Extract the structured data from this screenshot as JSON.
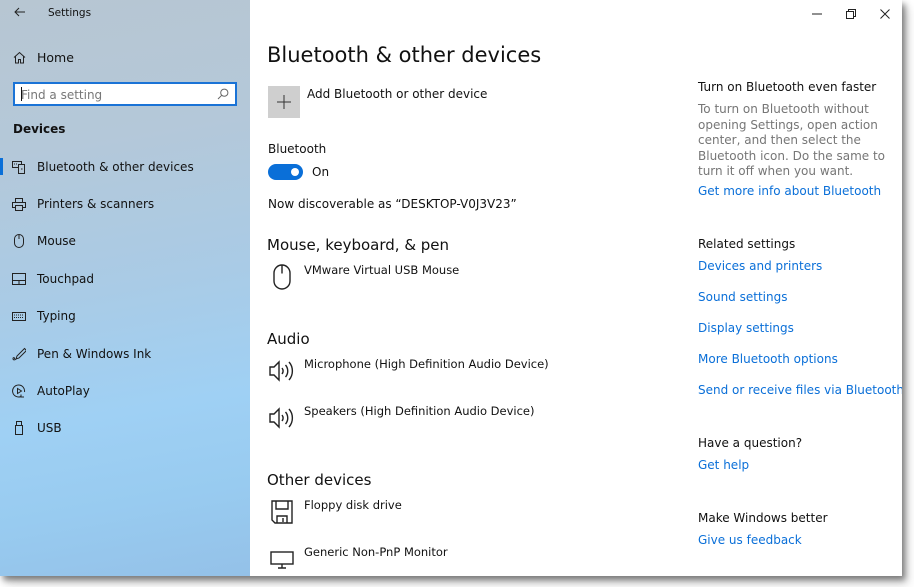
{
  "window": {
    "app_title": "Settings",
    "controls": [
      "minimize",
      "restore",
      "close"
    ]
  },
  "sidebar": {
    "home_label": "Home",
    "search": {
      "placeholder": "Find a setting",
      "value": ""
    },
    "section_label": "Devices",
    "items": [
      {
        "label": "Bluetooth & other devices",
        "icon": "bluetooth-devices-icon",
        "selected": true
      },
      {
        "label": "Printers & scanners",
        "icon": "printer-icon",
        "selected": false
      },
      {
        "label": "Mouse",
        "icon": "mouse-icon",
        "selected": false
      },
      {
        "label": "Touchpad",
        "icon": "touchpad-icon",
        "selected": false
      },
      {
        "label": "Typing",
        "icon": "keyboard-icon",
        "selected": false
      },
      {
        "label": "Pen & Windows Ink",
        "icon": "pen-icon",
        "selected": false
      },
      {
        "label": "AutoPlay",
        "icon": "autoplay-icon",
        "selected": false
      },
      {
        "label": "USB",
        "icon": "usb-icon",
        "selected": false
      }
    ]
  },
  "main": {
    "title": "Bluetooth & other devices",
    "add_device_label": "Add Bluetooth or other device",
    "bluetooth": {
      "label": "Bluetooth",
      "state": "On",
      "enabled": true,
      "discoverable_text": "Now discoverable as “DESKTOP-V0J3V23”"
    },
    "groups": [
      {
        "title": "Mouse, keyboard, & pen",
        "devices": [
          {
            "name": "VMware Virtual USB Mouse",
            "icon": "mouse-icon"
          }
        ]
      },
      {
        "title": "Audio",
        "devices": [
          {
            "name": "Microphone (High Definition Audio Device)",
            "icon": "speaker-icon"
          },
          {
            "name": "Speakers (High Definition Audio Device)",
            "icon": "speaker-icon"
          }
        ]
      },
      {
        "title": "Other devices",
        "devices": [
          {
            "name": "Floppy disk drive",
            "icon": "floppy-disk-icon"
          },
          {
            "name": "Generic Non-PnP Monitor",
            "icon": "monitor-icon"
          }
        ]
      }
    ]
  },
  "aside": {
    "tip_header": "Turn on Bluetooth even faster",
    "tip_text": "To turn on Bluetooth without opening Settings, open action center, and then select the Bluetooth icon. Do the same to turn it off when you want.",
    "tip_link": "Get more info about Bluetooth",
    "related_header": "Related settings",
    "related_links": [
      "Devices and printers",
      "Sound settings",
      "Display settings",
      "More Bluetooth options",
      "Send or receive files via Bluetooth"
    ],
    "question_header": "Have a question?",
    "help_link": "Get help",
    "feedback_header": "Make Windows better",
    "feedback_link": "Give us feedback"
  },
  "colors": {
    "accent": "#0a6fd8",
    "secondary_text": "#767676",
    "add_tile": "#cfcfcf"
  }
}
